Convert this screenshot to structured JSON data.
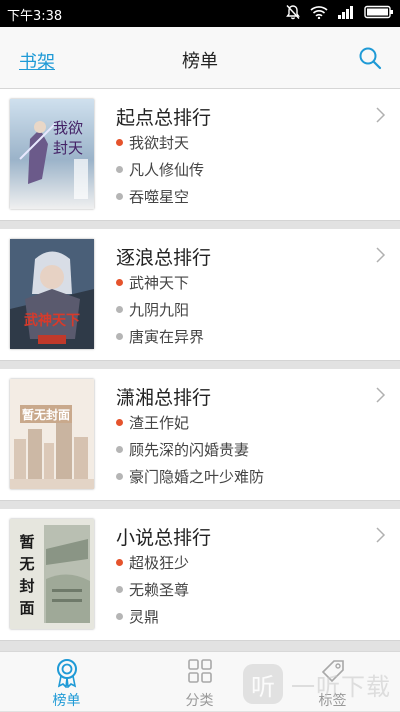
{
  "status_bar": {
    "time": "下午3:38"
  },
  "header": {
    "back_label": "书架",
    "title": "榜单"
  },
  "rankings": [
    {
      "title": "起点总排行",
      "cover_text": "我欲封天",
      "books": [
        "我欲封天",
        "凡人修仙传",
        "吞噬星空"
      ]
    },
    {
      "title": "逐浪总排行",
      "cover_text": "武神天下",
      "books": [
        "武神天下",
        "九阴九阳",
        "唐寅在异界"
      ]
    },
    {
      "title": "潇湘总排行",
      "cover_text": "暂无封面",
      "books": [
        "渣王作妃",
        "顾先深的闪婚贵妻",
        "豪门隐婚之叶少难防"
      ]
    },
    {
      "title": "小说总排行",
      "cover_text": "暂无封面",
      "books": [
        "超极狂少",
        "无赖圣尊",
        "灵鼎"
      ]
    }
  ],
  "tabs": [
    {
      "label": "榜单",
      "icon": "medal-icon",
      "active": true
    },
    {
      "label": "分类",
      "icon": "grid-icon",
      "active": false
    },
    {
      "label": "标签",
      "icon": "tag-icon",
      "active": false
    }
  ],
  "watermark": {
    "logo": "听",
    "text": "一听下载"
  },
  "colors": {
    "accent": "#1f9ad6",
    "hot_dot": "#e5532c",
    "normal_dot": "#b5b5b5"
  }
}
